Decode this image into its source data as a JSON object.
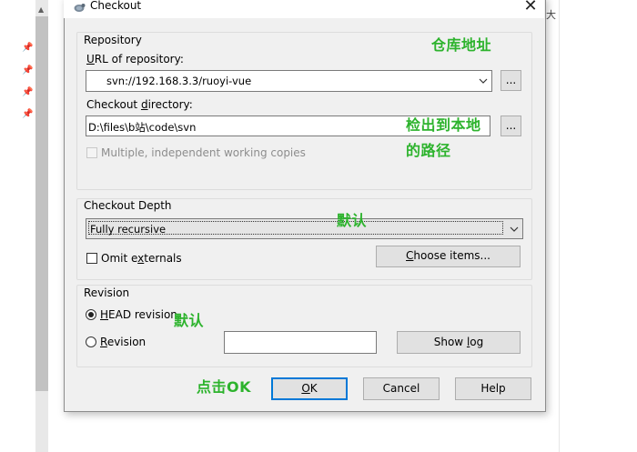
{
  "dialog": {
    "title": "Checkout",
    "close_label": "✕"
  },
  "repository": {
    "group_label": "Repository",
    "url_label": "URL of repository:",
    "url_value": "svn://192.168.3.3/ruoyi-vue",
    "browse_label": "...",
    "dir_label": "Checkout directory:",
    "dir_value": "D:\\files\\b站\\code\\svn",
    "dir_browse_label": "...",
    "multiple_label": "Multiple, independent working copies"
  },
  "depth": {
    "group_label": "Checkout Depth",
    "selected": "Fully recursive",
    "omit_label": "Omit externals",
    "choose_label": "Choose items..."
  },
  "revision": {
    "group_label": "Revision",
    "head_label": "HEAD revision",
    "rev_label": "Revision",
    "rev_value": "",
    "show_log_label": "Show log"
  },
  "buttons": {
    "ok": "OK",
    "cancel": "Cancel",
    "help": "Help"
  },
  "annotations": {
    "repo_addr": "仓库地址",
    "checkout_path_1": "检出到本地",
    "checkout_path_2": "的路径",
    "default_depth": "默认",
    "default_revision": "默认",
    "click_ok": "点击OK"
  },
  "background": {
    "right_text": "大"
  },
  "colors": {
    "annotation": "#2db32d",
    "default_button_border": "#0078d7",
    "dialog_bg": "#f0f0f0"
  }
}
